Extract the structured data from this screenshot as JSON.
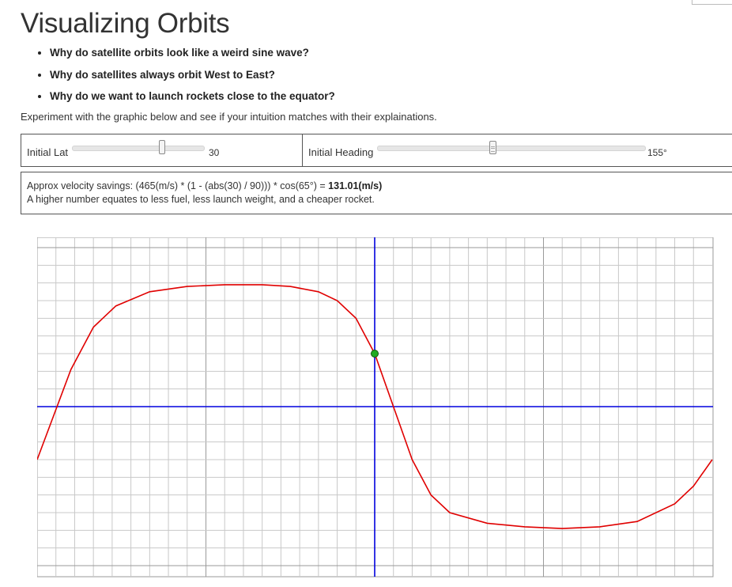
{
  "page": {
    "title": "Visualizing Orbits",
    "questions": [
      "Why do satellite orbits look like a weird sine wave?",
      "Why do satellites always orbit West to East?",
      "Why do we want to launch rockets close to the equator?"
    ],
    "intro": "Experiment with the graphic below and see if your intuition matches with their explainations."
  },
  "controls": {
    "latitude": {
      "label": "Initial Lat",
      "value": "30",
      "fraction": 0.68
    },
    "heading": {
      "label": "Initial Heading",
      "value": "155°",
      "fraction": 0.43
    }
  },
  "info": {
    "formula_prefix": "Approx velocity savings: (465(m/s) * (1 - (abs(30) / 90))) * cos(65°) = ",
    "result": "131.01(m/s)",
    "note": "A higher number equates to less fuel, less launch weight, and a cheaper rocket."
  },
  "colors": {
    "orbit_curve": "#e00000",
    "axes": "#0000dd",
    "grid_minor": "#c8c8c8",
    "grid_major": "#9a9a9a",
    "launch_point": "#22aa22"
  },
  "chart_data": {
    "type": "line",
    "x_range": [
      -180,
      180
    ],
    "y_range": [
      -90,
      90
    ],
    "launch_point": {
      "lon": 0,
      "lat": 30
    },
    "series": [
      {
        "points": [
          [
            -180,
            -30
          ],
          [
            -162,
            21
          ],
          [
            -150,
            45
          ],
          [
            -138,
            57
          ],
          [
            -120,
            65
          ],
          [
            -100,
            68
          ],
          [
            -80,
            69
          ],
          [
            -60,
            69
          ],
          [
            -45,
            68
          ],
          [
            -30,
            65
          ],
          [
            -20,
            60
          ],
          [
            -10,
            50
          ],
          [
            0,
            30
          ],
          [
            10,
            0
          ],
          [
            20,
            -30
          ],
          [
            30,
            -50
          ],
          [
            40,
            -60
          ],
          [
            60,
            -66
          ],
          [
            80,
            -68
          ],
          [
            100,
            -69
          ],
          [
            120,
            -68
          ],
          [
            140,
            -65
          ],
          [
            160,
            -55
          ],
          [
            170,
            -45
          ],
          [
            180,
            -30
          ]
        ]
      }
    ]
  }
}
